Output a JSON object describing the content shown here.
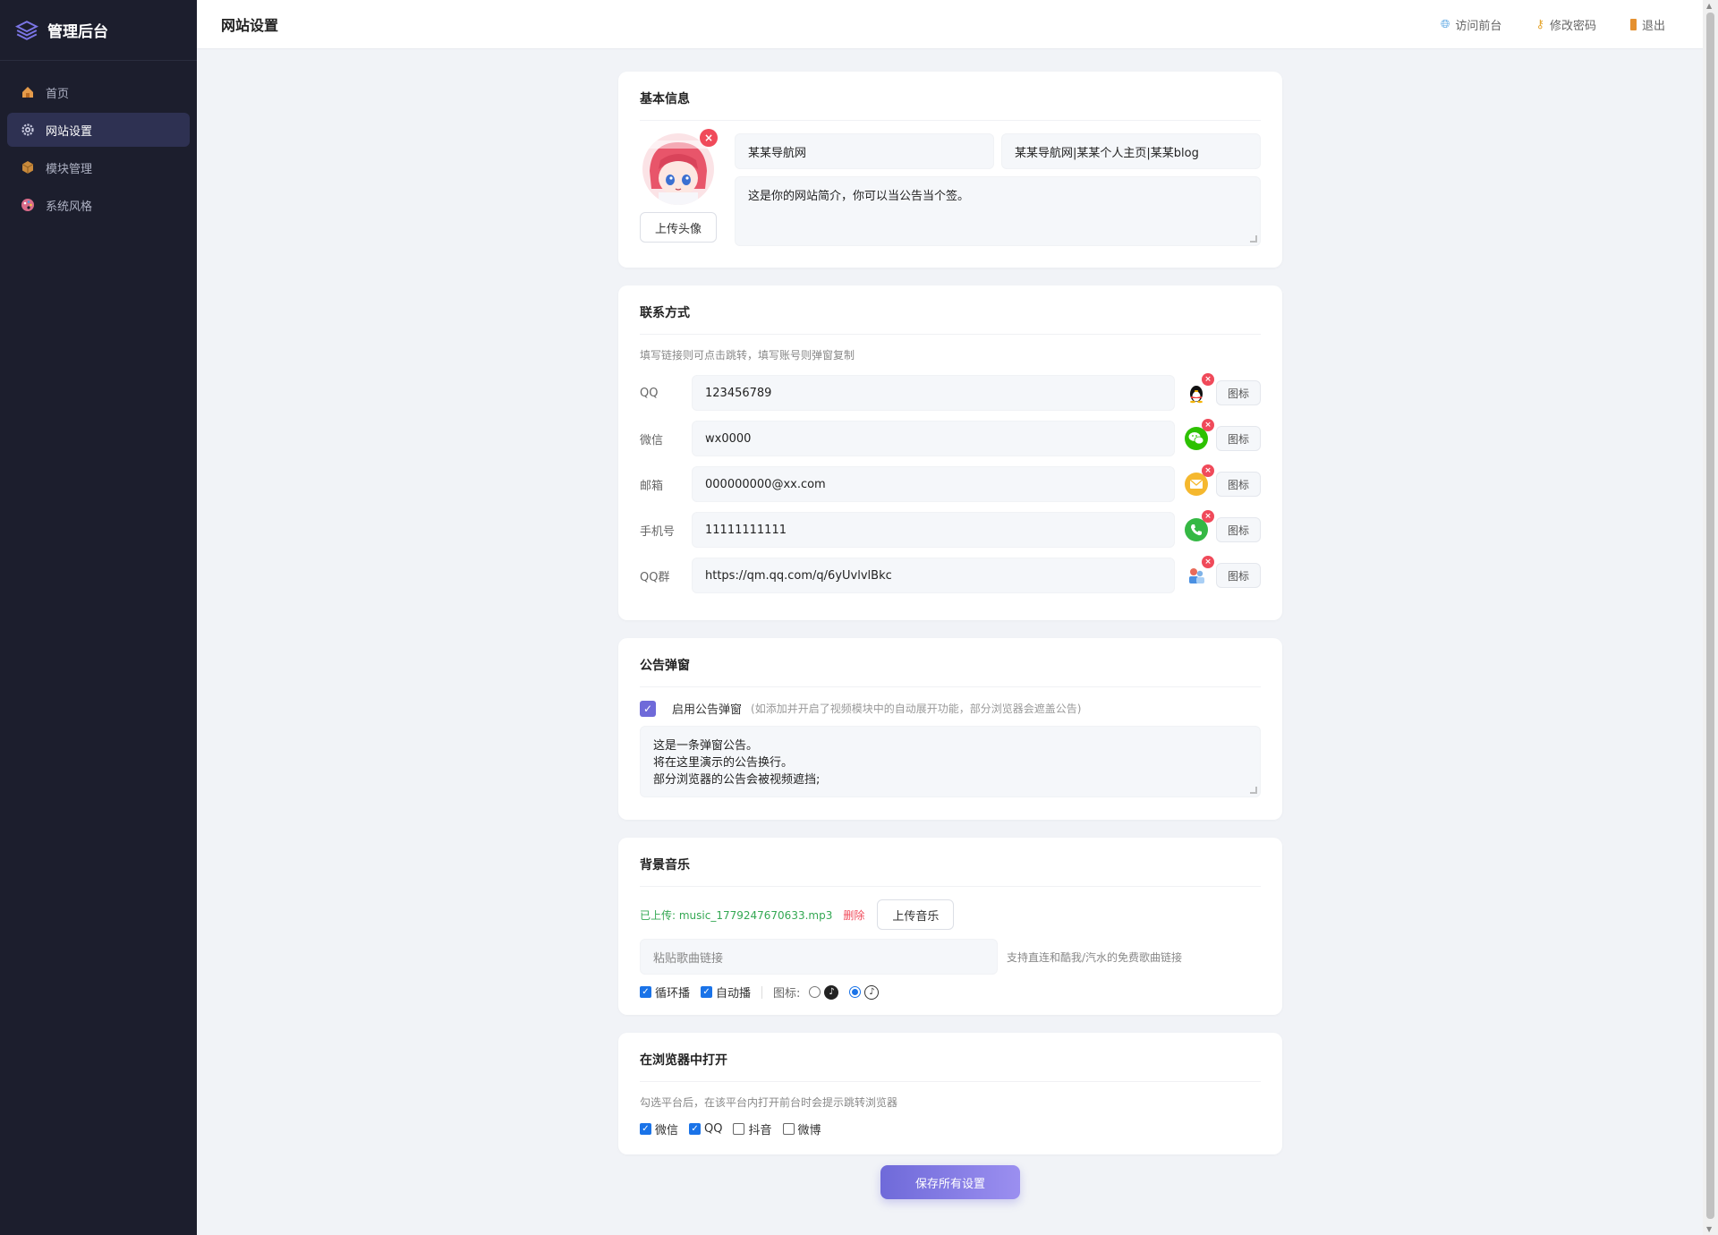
{
  "app": {
    "title": "管理后台"
  },
  "sidebar": {
    "items": [
      {
        "label": "首页",
        "icon": "home-icon",
        "active": false
      },
      {
        "label": "网站设置",
        "icon": "gear-icon",
        "active": true
      },
      {
        "label": "模块管理",
        "icon": "cube-icon",
        "active": false
      },
      {
        "label": "系统风格",
        "icon": "palette-icon",
        "active": false
      }
    ]
  },
  "topbar": {
    "title": "网站设置",
    "links": [
      {
        "label": "访问前台",
        "icon": "globe-icon"
      },
      {
        "label": "修改密码",
        "icon": "key-icon"
      },
      {
        "label": "退出",
        "icon": "exit-icon"
      }
    ]
  },
  "basic": {
    "title": "基本信息",
    "upload_avatar": "上传头像",
    "site_name": "某某导航网",
    "site_title": "某某导航网|某某个人主页|某某blog",
    "intro": "这是你的网站简介，你可以当公告当个签。"
  },
  "contact": {
    "title": "联系方式",
    "hint": "填写链接则可点击跳转，填写账号则弹窗复制",
    "icon_button": "图标",
    "rows": [
      {
        "label": "QQ",
        "value": "123456789",
        "icon": "qq-penguin-icon"
      },
      {
        "label": "微信",
        "value": "wx0000",
        "icon": "wechat-icon"
      },
      {
        "label": "邮箱",
        "value": "000000000@xx.com",
        "icon": "mail-icon"
      },
      {
        "label": "手机号",
        "value": "11111111111",
        "icon": "phone-icon"
      },
      {
        "label": "QQ群",
        "value": "https://qm.qq.com/q/6yUvlvlBkc",
        "icon": "qq-group-icon"
      }
    ]
  },
  "notice": {
    "title": "公告弹窗",
    "enable_label": "启用公告弹窗",
    "enable_hint": "(如添加并开启了视频模块中的自动展开功能，部分浏览器会遮盖公告)",
    "enabled": true,
    "lines": [
      "这是一条弹窗公告。",
      "将在这里演示的公告换行。",
      "部分浏览器的公告会被视频遮挡;"
    ]
  },
  "music": {
    "title": "背景音乐",
    "uploaded": "已上传: music_1779247670633.mp3",
    "delete": "删除",
    "upload_button": "上传音乐",
    "link_placeholder": "粘贴歌曲链接",
    "link_hint": "支持直连和酷我/汽水的免费歌曲链接",
    "loop_label": "循环播",
    "autoplay_label": "自动播",
    "icon_label": "图标:",
    "loop": true,
    "autoplay": true,
    "icon_choice": 2
  },
  "browser": {
    "title": "在浏览器中打开",
    "hint": "勾选平台后，在该平台内打开前台时会提示跳转浏览器",
    "options": [
      {
        "label": "微信",
        "checked": true
      },
      {
        "label": "QQ",
        "checked": true
      },
      {
        "label": "抖音",
        "checked": false
      },
      {
        "label": "微博",
        "checked": false
      }
    ]
  },
  "save_button": "保存所有设置",
  "colors": {
    "sidebar_bg": "#1c1e2d",
    "accent": "#6f6ad9",
    "danger": "#f04a5a",
    "success": "#34a853"
  }
}
